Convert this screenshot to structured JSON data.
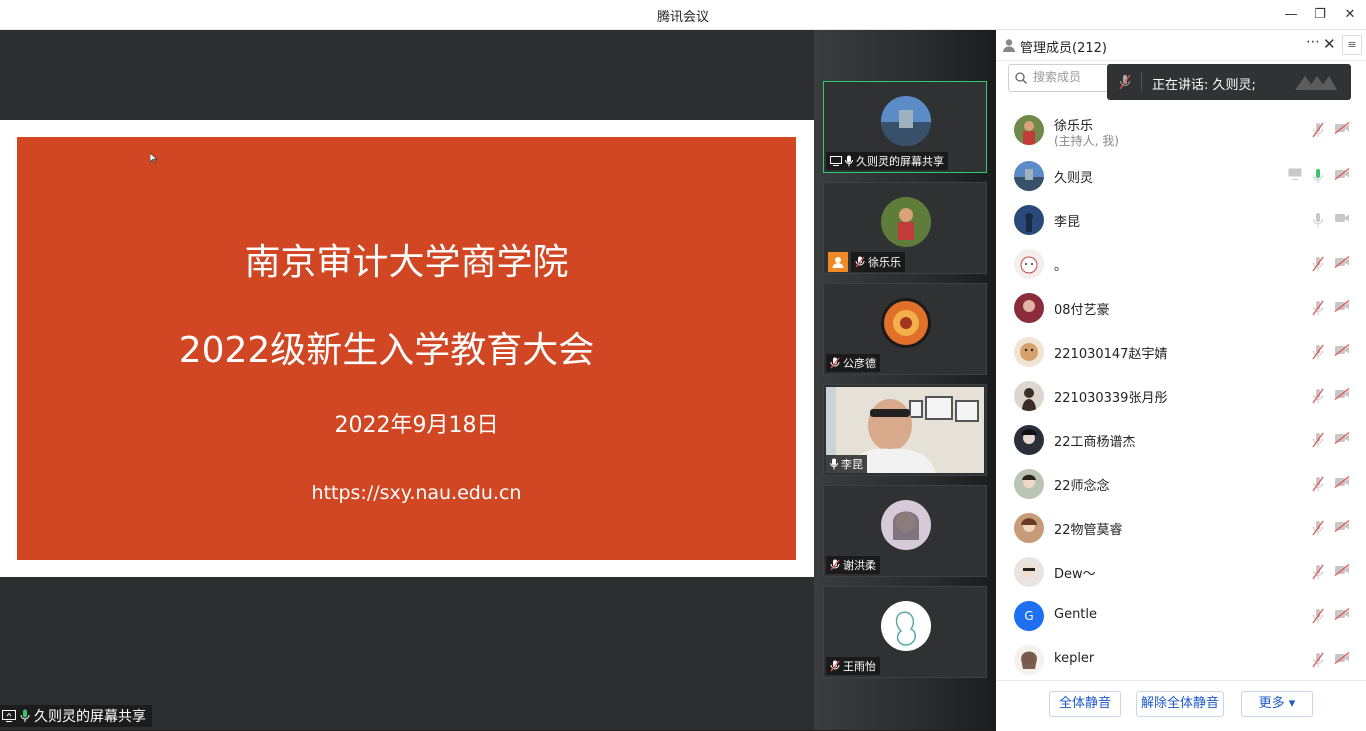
{
  "window": {
    "title": "腾讯会议"
  },
  "slide": {
    "line1": "南京审计大学商学院",
    "line2": "2022级新生入学教育大会",
    "line3": "2022年9月18日",
    "line4": "https://sxy.nau.edu.cn",
    "bg_color": "#d14623"
  },
  "share_badge": "久则灵的屏幕共享",
  "video_tiles": [
    {
      "name": "久则灵的屏幕共享",
      "active": true
    },
    {
      "name": "徐乐乐"
    },
    {
      "name": "公彦德"
    },
    {
      "name": "李昆"
    },
    {
      "name": "谢洪柔"
    },
    {
      "name": "王雨怡"
    }
  ],
  "panel": {
    "title": "管理成员(212)",
    "search_placeholder": "搜索成员",
    "speaking_toast": "正在讲话: 久则灵;",
    "members": [
      {
        "name": "徐乐乐",
        "sub": "(主持人, 我)",
        "mic": "muted",
        "cam": "off"
      },
      {
        "name": "久则灵",
        "mic": "on",
        "cam": "off",
        "sharing": true
      },
      {
        "name": "李昆",
        "mic": "on-idle",
        "cam": "on"
      },
      {
        "name": "。",
        "mic": "muted",
        "cam": "off"
      },
      {
        "name": "08付艺豪",
        "mic": "muted",
        "cam": "off"
      },
      {
        "name": "221030147赵宇婧",
        "mic": "muted",
        "cam": "off"
      },
      {
        "name": "221030339张月彤",
        "mic": "muted",
        "cam": "off"
      },
      {
        "name": "22工商杨谱杰",
        "mic": "muted",
        "cam": "off"
      },
      {
        "name": "22师念念",
        "mic": "muted",
        "cam": "off"
      },
      {
        "name": "22物管莫睿",
        "mic": "muted",
        "cam": "off"
      },
      {
        "name": "Dew～",
        "mic": "muted",
        "cam": "off"
      },
      {
        "name": "Gentle",
        "mic": "muted",
        "cam": "off",
        "avatar_letter": "G"
      },
      {
        "name": "kepler",
        "mic": "muted",
        "cam": "off"
      }
    ],
    "buttons": {
      "mute_all": "全体静音",
      "unmute_all": "解除全体静音",
      "more": "更多 ▾"
    }
  },
  "colors": {
    "accent": "#1e5ac8",
    "active_border": "#2ecc71",
    "muted_red": "#e05555"
  }
}
